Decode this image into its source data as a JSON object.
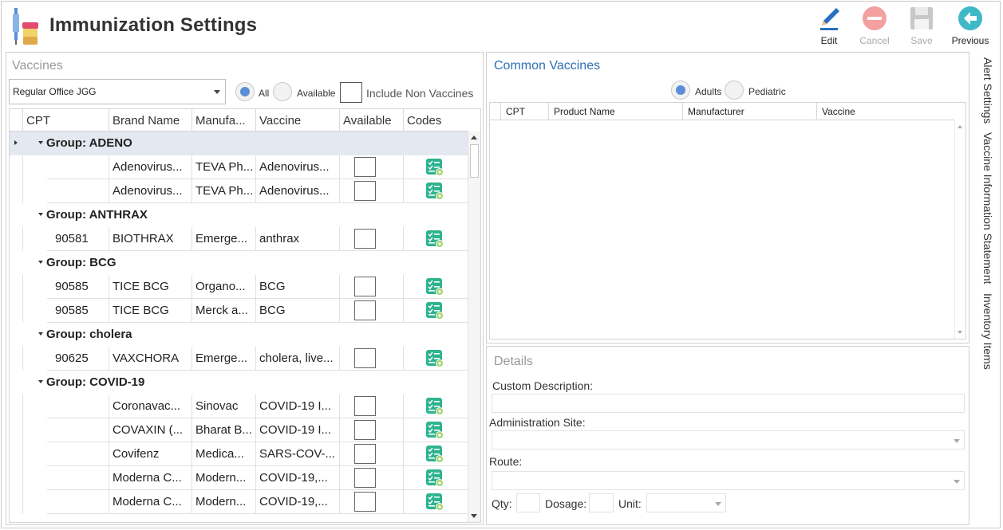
{
  "app": {
    "title": "Immunization Settings",
    "icon": "syringe-vials-icon"
  },
  "toolbar": {
    "edit": "Edit",
    "cancel": "Cancel",
    "save": "Save",
    "previous": "Previous"
  },
  "vaccines": {
    "title": "Vaccines",
    "location": "Regular Office JGG",
    "filter_all": "All",
    "filter_available": "Available",
    "include_non": "Include Non Vaccines",
    "columns": [
      "CPT",
      "Brand Name",
      "Manufa...",
      "Vaccine",
      "Available",
      "Codes"
    ],
    "groups": [
      {
        "label": "Group: ADENO",
        "rows": [
          {
            "cpt": "",
            "brand": "Adenovirus...",
            "manu": "TEVA Ph...",
            "vaccine": "Adenovirus..."
          },
          {
            "cpt": "",
            "brand": "Adenovirus...",
            "manu": "TEVA Ph...",
            "vaccine": "Adenovirus..."
          }
        ]
      },
      {
        "label": "Group: ANTHRAX",
        "rows": [
          {
            "cpt": "90581",
            "brand": "BIOTHRAX",
            "manu": "Emerge...",
            "vaccine": "anthrax"
          }
        ]
      },
      {
        "label": "Group: BCG",
        "rows": [
          {
            "cpt": "90585",
            "brand": "TICE BCG",
            "manu": "Organo...",
            "vaccine": "BCG"
          },
          {
            "cpt": "90585",
            "brand": "TICE BCG",
            "manu": "Merck a...",
            "vaccine": "BCG"
          }
        ]
      },
      {
        "label": "Group: cholera",
        "rows": [
          {
            "cpt": "90625",
            "brand": "VAXCHORA",
            "manu": "Emerge...",
            "vaccine": "cholera, live..."
          }
        ]
      },
      {
        "label": "Group: COVID-19",
        "rows": [
          {
            "cpt": "",
            "brand": "Coronavac...",
            "manu": "Sinovac",
            "vaccine": "COVID-19 I..."
          },
          {
            "cpt": "",
            "brand": "COVAXIN (...",
            "manu": "Bharat B...",
            "vaccine": "COVID-19 I..."
          },
          {
            "cpt": "",
            "brand": "Covifenz",
            "manu": "Medica...",
            "vaccine": "SARS-COV-..."
          },
          {
            "cpt": "",
            "brand": "Moderna C...",
            "manu": "Modern...",
            "vaccine": "COVID-19,..."
          },
          {
            "cpt": "",
            "brand": "Moderna C...",
            "manu": "Modern...",
            "vaccine": "COVID-19,..."
          }
        ]
      }
    ]
  },
  "common": {
    "title": "Common Vaccines",
    "filter_adults": "Adults",
    "filter_pediatric": "Pediatric",
    "columns": [
      "CPT",
      "Product Name",
      "Manufacturer",
      "Vaccine"
    ]
  },
  "details": {
    "title": "Details",
    "custom_description": "Custom Description:",
    "admin_site": "Administration Site:",
    "route": "Route:",
    "qty": "Qty:",
    "dosage": "Dosage:",
    "unit": "Unit:"
  },
  "side_tabs": [
    "Alert Settings",
    "Vaccine Information Statement",
    "Inventory Items"
  ],
  "colors": {
    "accent": "#2f6fb3",
    "code_icon": "#2db38f",
    "radio_on": "#5b8ed6",
    "edit_blue": "#2a6fc0",
    "previous_teal": "#3fb8c8"
  }
}
